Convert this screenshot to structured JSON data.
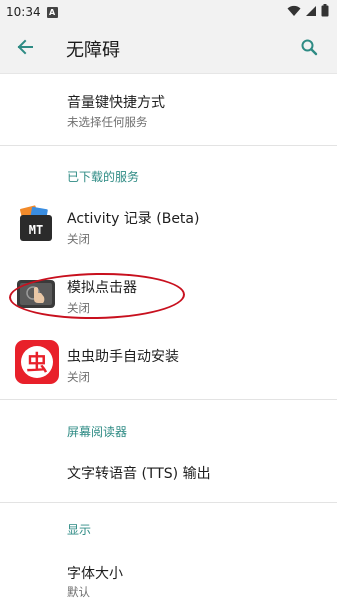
{
  "status_bar": {
    "time": "10:34",
    "notif_glyph": "A"
  },
  "app_bar": {
    "title": "无障碍"
  },
  "items": {
    "volume_shortcut": {
      "title": "音量键快捷方式",
      "subtitle": "未选择任何服务"
    },
    "section_downloaded": "已下载的服务",
    "activity": {
      "title": "Activity 记录 (Beta)",
      "subtitle": "关闭",
      "icon_text": "MT"
    },
    "simulator": {
      "title": "模拟点击器",
      "subtitle": "关闭"
    },
    "chongchong": {
      "title": "虫虫助手自动安装",
      "subtitle": "关闭",
      "icon_text": "虫"
    },
    "section_screen_reader": "屏幕阅读器",
    "tts": {
      "title": "文字转语音 (TTS) 输出"
    },
    "section_display": "显示",
    "font_size": {
      "title": "字体大小",
      "subtitle": "默认"
    }
  },
  "colors": {
    "accent": "#2e8b84",
    "highlight_ring": "#c8101e",
    "chongchong_red": "#e8202a"
  }
}
